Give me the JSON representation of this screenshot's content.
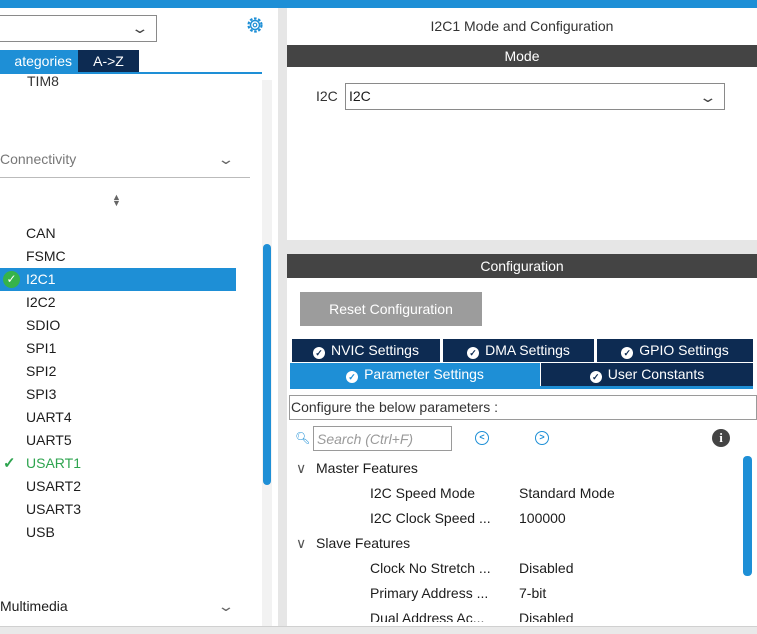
{
  "left_pane": {
    "category_select_value": "",
    "tabs": {
      "categories": "ategories",
      "az": "A->Z"
    },
    "cut_item": "TIM8",
    "connectivity_header": "Connectivity",
    "peripherals": [
      {
        "label": "CAN",
        "state": "none"
      },
      {
        "label": "FSMC",
        "state": "none"
      },
      {
        "label": "I2C1",
        "state": "selected"
      },
      {
        "label": "I2C2",
        "state": "none"
      },
      {
        "label": "SDIO",
        "state": "none"
      },
      {
        "label": "SPI1",
        "state": "none"
      },
      {
        "label": "SPI2",
        "state": "none"
      },
      {
        "label": "SPI3",
        "state": "none"
      },
      {
        "label": "UART4",
        "state": "none"
      },
      {
        "label": "UART5",
        "state": "none"
      },
      {
        "label": "USART1",
        "state": "configured"
      },
      {
        "label": "USART2",
        "state": "none"
      },
      {
        "label": "USART3",
        "state": "none"
      },
      {
        "label": "USB",
        "state": "none"
      }
    ],
    "multimedia_header": "Multimedia"
  },
  "mode_panel": {
    "title": "I2C1 Mode and Configuration",
    "section": "Mode",
    "i2c_label": "I2C",
    "i2c_value": "I2C"
  },
  "config_panel": {
    "section": "Configuration",
    "reset_label": "Reset Configuration",
    "tabs": {
      "nvic": "NVIC Settings",
      "dma": "DMA Settings",
      "gpio": "GPIO Settings",
      "parameter": "Parameter Settings",
      "user": "User Constants"
    },
    "hint": "Configure the below parameters :",
    "search_placeholder": "Search (Ctrl+F)",
    "groups": [
      {
        "label": "Master Features",
        "params": [
          {
            "name": "I2C Speed Mode",
            "value": "Standard Mode"
          },
          {
            "name": "I2C Clock Speed ...",
            "value": "100000"
          }
        ]
      },
      {
        "label": "Slave Features",
        "params": [
          {
            "name": "Clock No Stretch ...",
            "value": "Disabled"
          },
          {
            "name": "Primary Address ...",
            "value": "7-bit"
          },
          {
            "name": "Dual Address Ac...",
            "value": "Disabled"
          }
        ]
      }
    ]
  },
  "colors": {
    "accent": "#1e8fd6",
    "dark_tab": "#0d2b52",
    "header_bar": "#444444",
    "ok_green": "#2ea44f"
  },
  "icons": [
    "gear-icon",
    "chevron-down-icon",
    "check-circle-icon",
    "check-icon",
    "sort-icon",
    "search-icon",
    "prev-icon",
    "next-icon",
    "info-icon"
  ]
}
